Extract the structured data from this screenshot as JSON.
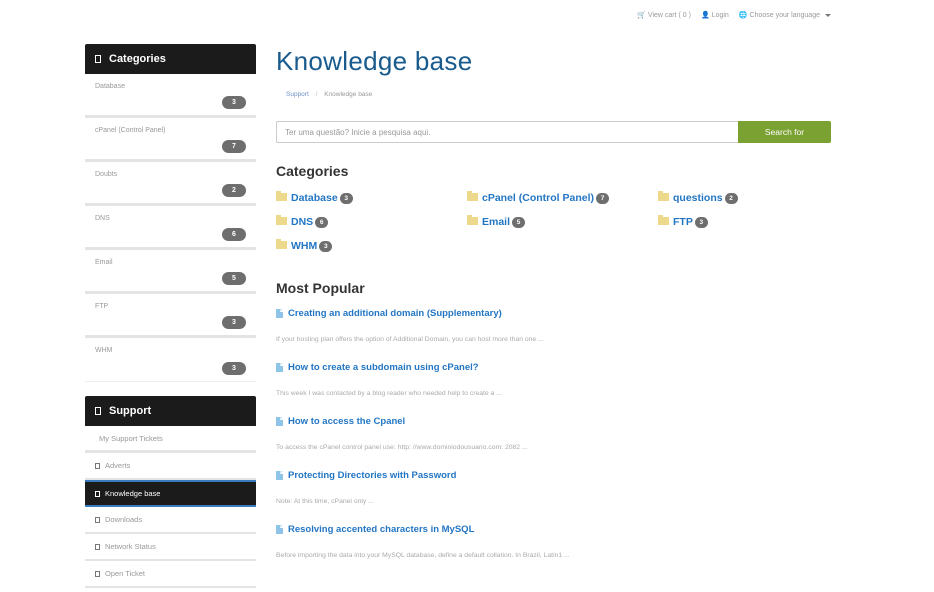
{
  "topbar": {
    "cart": "View cart ( 0 )",
    "login": "Login",
    "language": "Choose your language"
  },
  "sidebar": {
    "categories_title": "Categories",
    "categories": [
      {
        "label": "Database",
        "count": "3"
      },
      {
        "label": "cPanel (Control Panel)",
        "count": "7"
      },
      {
        "label": "Doubts",
        "count": "2"
      },
      {
        "label": "DNS",
        "count": "6"
      },
      {
        "label": "Email",
        "count": "5"
      },
      {
        "label": "FTP",
        "count": "3"
      },
      {
        "label": "WHM",
        "count": "3"
      }
    ],
    "support_title": "Support",
    "support_items": [
      {
        "label": "My Support Tickets"
      },
      {
        "label": "Adverts"
      },
      {
        "label": "Knowledge base",
        "active": true
      },
      {
        "label": "Downloads"
      },
      {
        "label": "Network Status"
      },
      {
        "label": "Open Ticket"
      }
    ]
  },
  "main": {
    "title": "Knowledge base",
    "breadcrumb": [
      {
        "label": "Support"
      },
      {
        "label": "Knowledge base"
      }
    ],
    "search": {
      "placeholder": "Ter uma questão? Inicie a pesquisa aqui.",
      "button": "Search for"
    },
    "categories_title": "Categories",
    "categories": [
      {
        "label": "Database",
        "count": "3"
      },
      {
        "label": "cPanel (Control Panel)",
        "count": "7"
      },
      {
        "label": "questions",
        "count": "2"
      },
      {
        "label": "DNS",
        "count": "6"
      },
      {
        "label": "Email",
        "count": "5"
      },
      {
        "label": "FTP",
        "count": "3"
      },
      {
        "label": "WHM",
        "count": "3"
      }
    ],
    "popular_title": "Most Popular",
    "articles": [
      {
        "title": "Creating an additional domain (Supplementary)",
        "snippet": "If your hosting plan offers the option of Additional Domain, you can host more than one ..."
      },
      {
        "title": "How to create a subdomain using cPanel?",
        "snippet": "This week I was contacted by a blog reader who needed help to create a ..."
      },
      {
        "title": "How to access the Cpanel",
        "snippet": "To access the cPanel control panel use: http: //www.dominiodousuario.com: 2082 ..."
      },
      {
        "title": "Protecting Directories with Password",
        "snippet": "Note: At this time, cPanel only ..."
      },
      {
        "title": "Resolving accented characters in MySQL",
        "snippet": "Before importing the data into your MySQL database, define a default collation. In Brazil, Latin1 ..."
      }
    ]
  },
  "colors": {
    "accent_blue": "#2376c4",
    "title_blue": "#1a5b8e",
    "search_green": "#7aa132",
    "panel_dark": "#1b1b1b",
    "badge_gray": "#6e6e6e",
    "folder_yellow": "#ecd98c"
  }
}
